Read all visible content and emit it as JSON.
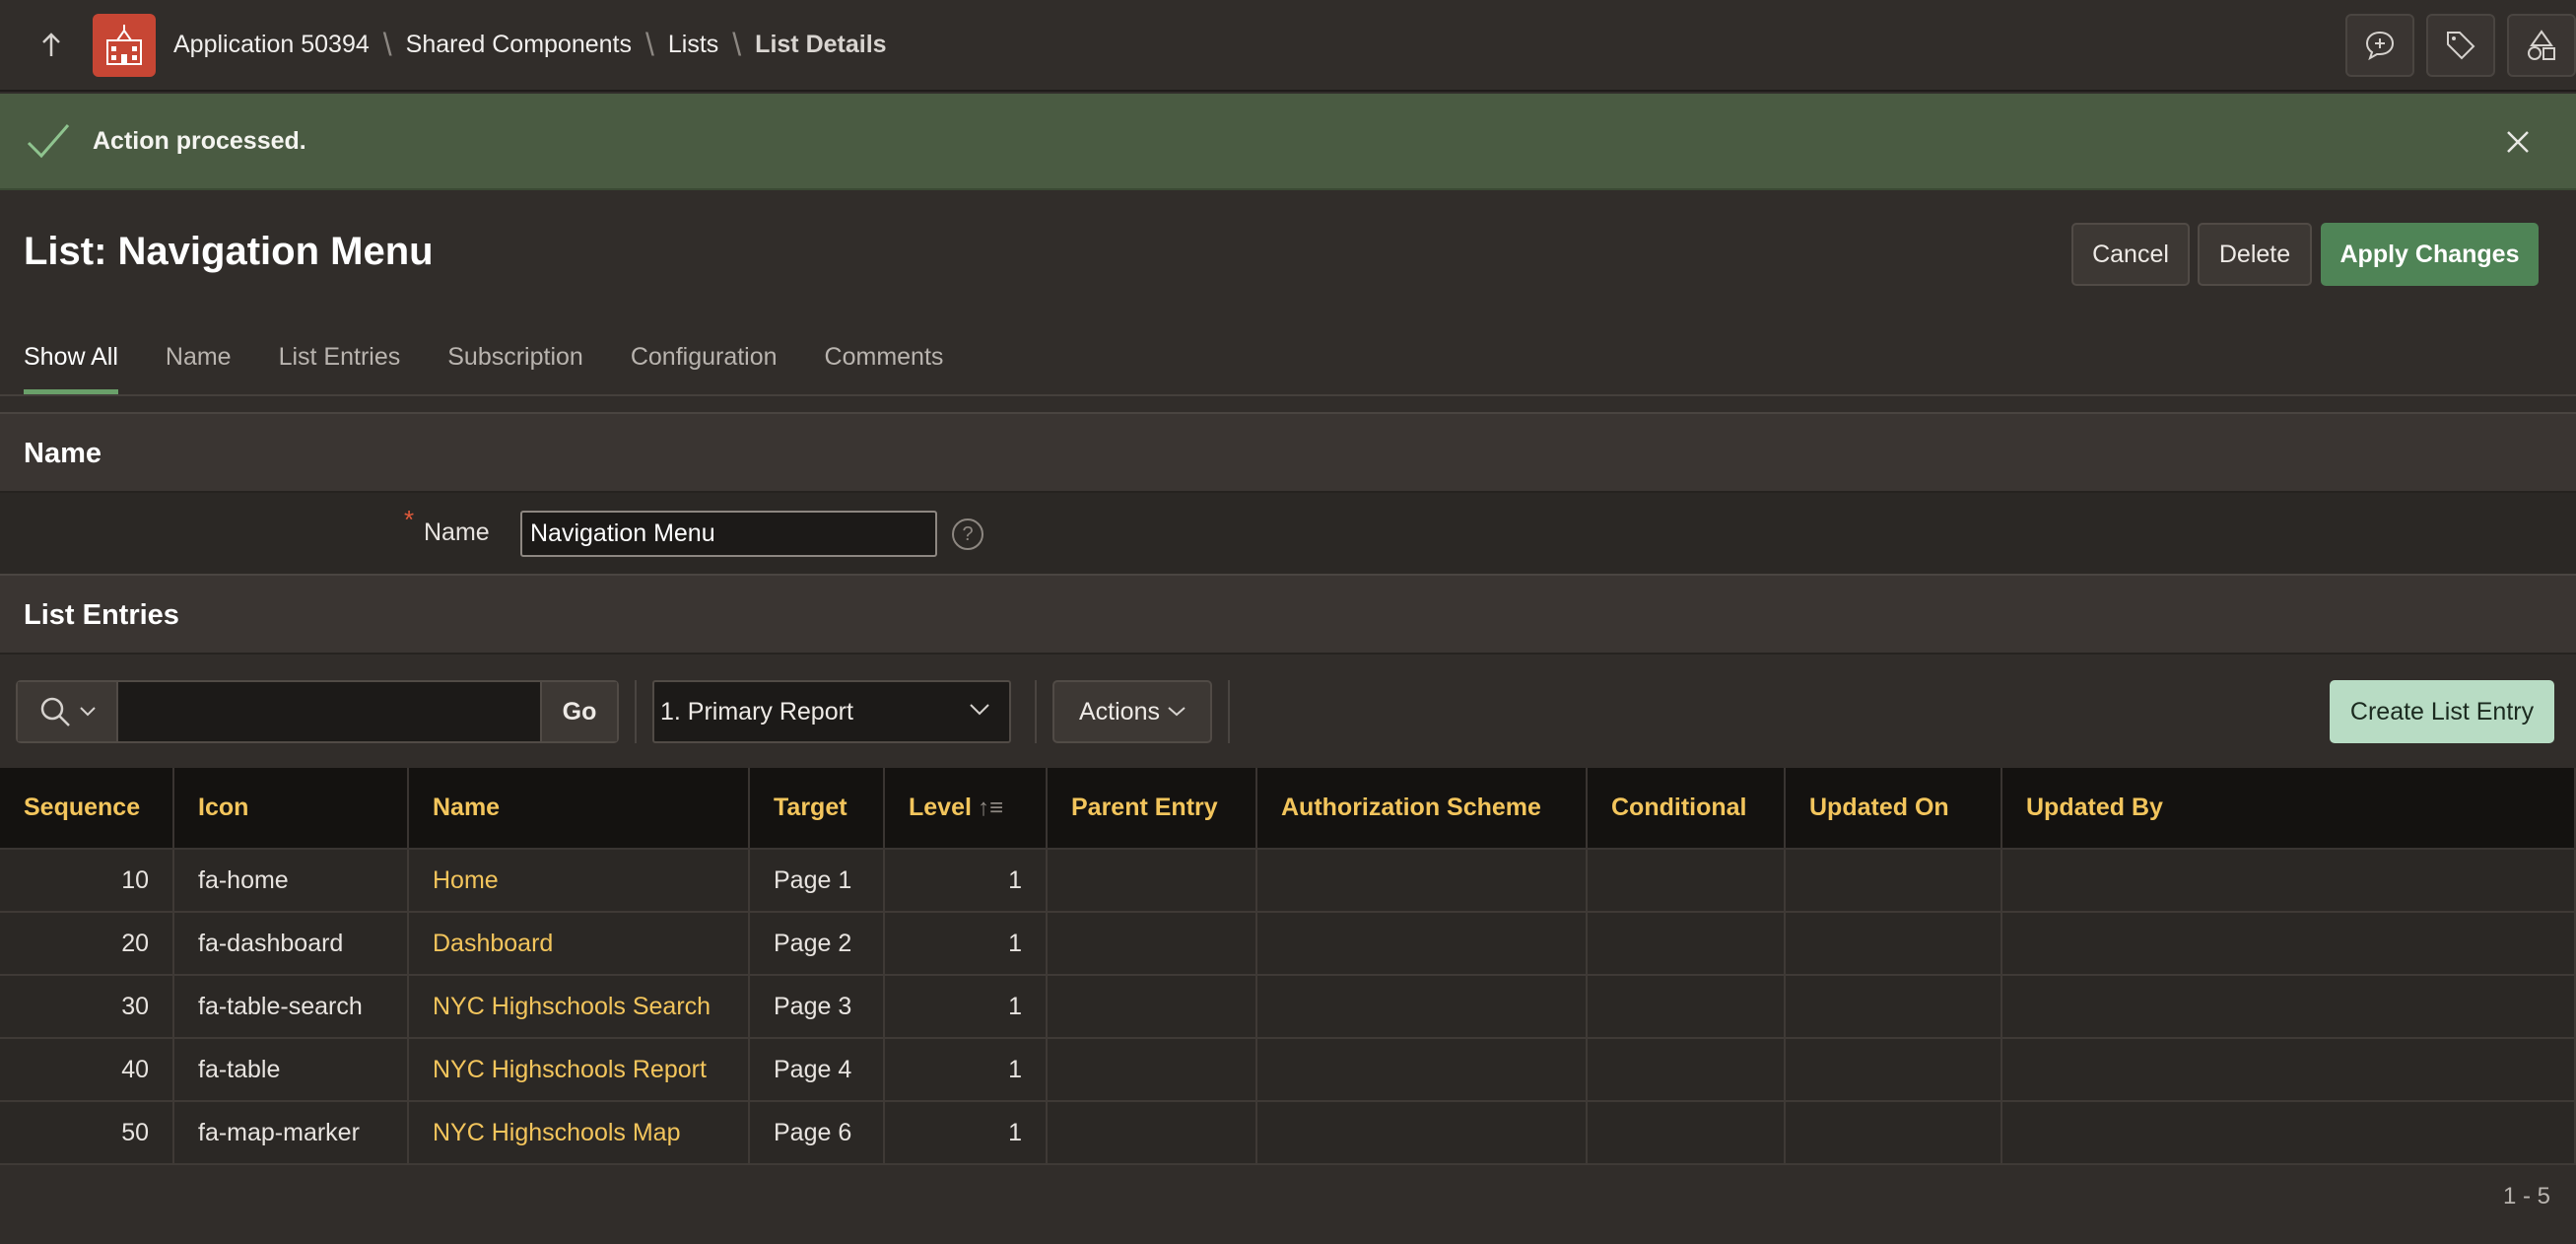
{
  "header": {
    "breadcrumbs": [
      {
        "label": "Application 50394"
      },
      {
        "label": "Shared Components"
      },
      {
        "label": "Lists"
      },
      {
        "label": "List Details"
      }
    ],
    "icons": [
      "up-arrow-icon",
      "app-logo-icon",
      "comment-add-icon",
      "tag-icon",
      "shapes-icon"
    ]
  },
  "alert": {
    "message": "Action processed.",
    "color": "#4a5b42"
  },
  "page": {
    "title": "List: Navigation Menu"
  },
  "buttons": {
    "cancel": "Cancel",
    "delete": "Delete",
    "apply": "Apply Changes"
  },
  "tabs": [
    {
      "label": "Show All",
      "active": true
    },
    {
      "label": "Name"
    },
    {
      "label": "List Entries"
    },
    {
      "label": "Subscription"
    },
    {
      "label": "Configuration"
    },
    {
      "label": "Comments"
    }
  ],
  "name_region": {
    "title": "Name",
    "field_label": "Name",
    "required_marker": "*",
    "value": "Navigation Menu",
    "help": "?"
  },
  "entries_region": {
    "title": "List Entries",
    "go_label": "Go",
    "search_value": "",
    "report_select": "1. Primary Report",
    "actions_label": "Actions",
    "create_label": "Create List Entry",
    "columns": [
      "Sequence",
      "Icon",
      "Name",
      "Target",
      "Level",
      "Parent Entry",
      "Authorization Scheme",
      "Conditional",
      "Updated On",
      "Updated By"
    ],
    "rows": [
      {
        "sequence": "10",
        "icon": "fa-home",
        "name": "Home",
        "target": "Page 1",
        "level": "1"
      },
      {
        "sequence": "20",
        "icon": "fa-dashboard",
        "name": "Dashboard",
        "target": "Page 2",
        "level": "1"
      },
      {
        "sequence": "30",
        "icon": "fa-table-search",
        "name": "NYC Highschools Search",
        "target": "Page 3",
        "level": "1"
      },
      {
        "sequence": "40",
        "icon": "fa-table",
        "name": "NYC Highschools Report",
        "target": "Page 4",
        "level": "1"
      },
      {
        "sequence": "50",
        "icon": "fa-map-marker",
        "name": "NYC Highschools Map",
        "target": "Page 6",
        "level": "1"
      }
    ],
    "pagination": "1 - 5"
  },
  "colors": {
    "accent_link": "#f3c55c",
    "apply_button": "#4f8456",
    "create_button": "#b8dcc4"
  }
}
